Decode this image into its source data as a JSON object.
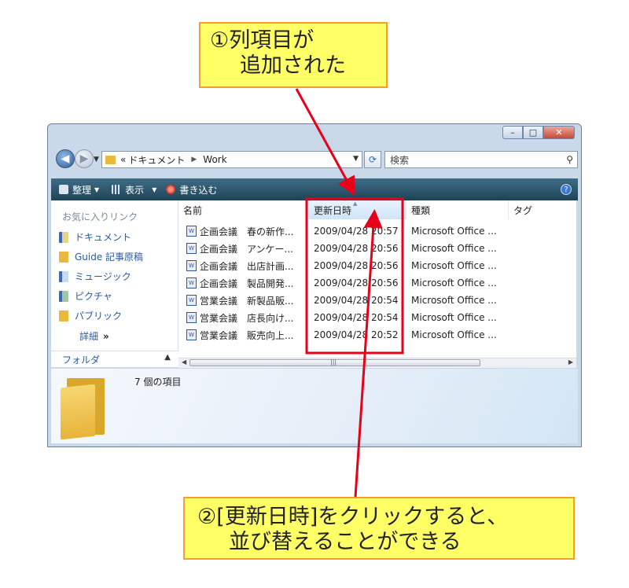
{
  "callouts": {
    "added": {
      "line1": "①列項目が",
      "line2": "追加された"
    },
    "sort": {
      "line1": "②[更新日時]をクリックすると、",
      "line2": "並び替えることができる"
    }
  },
  "address": {
    "chevron": "«",
    "crumbs": [
      "ドキュメント",
      "Work"
    ],
    "search_placeholder": "検索"
  },
  "toolbar": {
    "organize": "整理",
    "view": "表示",
    "burn": "書き込む"
  },
  "navpane": {
    "title": "お気に入りリンク",
    "items": [
      "ドキュメント",
      "Guide 記事原稿",
      "ミュージック",
      "ピクチャ",
      "パブリック"
    ],
    "more": "詳細",
    "more_glyph": "»",
    "folders": "フォルダ"
  },
  "filelist": {
    "columns": [
      "名前",
      "更新日時",
      "種類",
      "タグ"
    ],
    "rows": [
      {
        "name": "企画会議　春の新作...",
        "date": "2009/04/28 20:57",
        "type": "Microsoft Office ..."
      },
      {
        "name": "企画会議　アンケー...",
        "date": "2009/04/28 20:56",
        "type": "Microsoft Office ..."
      },
      {
        "name": "企画会議　出店計画...",
        "date": "2009/04/28 20:56",
        "type": "Microsoft Office ..."
      },
      {
        "name": "企画会議　製品開発...",
        "date": "2009/04/28 20:56",
        "type": "Microsoft Office ..."
      },
      {
        "name": "営業会議　新製品販...",
        "date": "2009/04/28 20:54",
        "type": "Microsoft Office ..."
      },
      {
        "name": "営業会議　店長向け...",
        "date": "2009/04/28 20:54",
        "type": "Microsoft Office ..."
      },
      {
        "name": "営業会議　販売向上...",
        "date": "2009/04/28 20:52",
        "type": "Microsoft Office ..."
      }
    ]
  },
  "details": {
    "item_count": "7 個の項目"
  },
  "colors": {
    "highlight": "#e8001a",
    "callout_fill": "#ffff66",
    "callout_border": "#f2a030",
    "toolbar": "#2a536b",
    "link": "#2b5a9c"
  }
}
